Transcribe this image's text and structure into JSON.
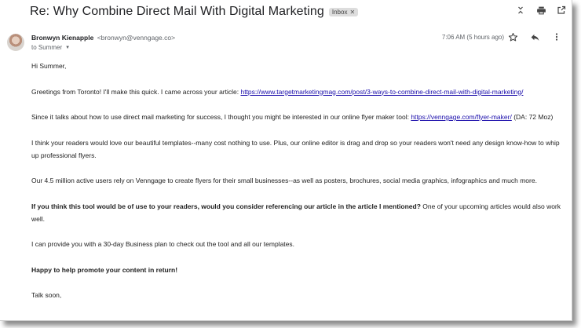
{
  "email": {
    "subject": "Re: Why Combine Direct Mail With Digital Marketing",
    "label_chip": "Inbox",
    "sender_name": "Bronwyn Kienapple",
    "sender_email": "<bronwyn@venngage.co>",
    "to_line": "to Summer",
    "time": "7:06 AM (5 hours ago)"
  },
  "icons": {
    "collapse": "unfold-less-icon",
    "print": "print-icon",
    "open_new": "open-in-new-icon",
    "star": "star-icon",
    "reply": "reply-icon",
    "more": "more-vert-icon"
  },
  "body": {
    "greeting": "Hi Summer,",
    "p1_text": "Greetings from Toronto! I'll make this quick. I came across your article: ",
    "p1_link": "https://www.targetmarketingmag.com/post/3-ways-to-combine-direct-mail-with-digital-marketing/",
    "p2_text": "Since it talks about how to use direct mail marketing for success, I thought you might be interested in our online flyer maker tool: ",
    "p2_link": "https://venngage.com/flyer-maker/",
    "p2_tail": " (DA: 72 Moz)",
    "p3": "I think your readers would love our beautiful templates--many cost nothing to use. Plus, our online editor is drag and drop so your readers won't need any design know-how to whip up professional flyers.",
    "p4": "Our 4.5 million active users rely on Venngage to create flyers for their small businesses--as well as posters, brochures, social media graphics, infographics and much more.",
    "p5_bold": "If you think this tool would be of use to your readers, would you consider referencing our article in the article I mentioned?",
    "p5_tail": " One of your upcoming articles would also work well.",
    "p6": "I can provide you with a 30-day Business plan to check out the tool and all our templates.",
    "p7_bold": "Happy to help promote your content in return!",
    "p8": "Talk soon,"
  }
}
